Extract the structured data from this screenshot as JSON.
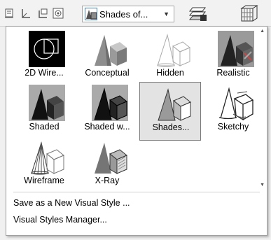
{
  "toolbar": {
    "icons": [
      "ucs-icon",
      "ucs-face-icon",
      "ucs-view-icon",
      "ucs-world-icon"
    ],
    "combo_value": "Shades of...",
    "combo_icon": "visual-style-icon",
    "right_icons": [
      "layered-planes-icon",
      "wireframe-box-icon"
    ]
  },
  "gallery": {
    "styles": [
      {
        "label": "2D Wire...",
        "icon": "2d-wireframe-thumb"
      },
      {
        "label": "Conceptual",
        "icon": "conceptual-thumb"
      },
      {
        "label": "Hidden",
        "icon": "hidden-thumb"
      },
      {
        "label": "Realistic",
        "icon": "realistic-thumb"
      },
      {
        "label": "Shaded",
        "icon": "shaded-thumb"
      },
      {
        "label": "Shaded w...",
        "icon": "shaded-with-edges-thumb"
      },
      {
        "label": "Shades...",
        "icon": "shades-of-gray-thumb",
        "selected": true
      },
      {
        "label": "Sketchy",
        "icon": "sketchy-thumb"
      },
      {
        "label": "Wireframe",
        "icon": "wireframe-thumb"
      },
      {
        "label": "X-Ray",
        "icon": "x-ray-thumb"
      }
    ]
  },
  "menu": {
    "save_label": "Save as a New Visual Style ...",
    "manager_label": "Visual Styles Manager..."
  }
}
